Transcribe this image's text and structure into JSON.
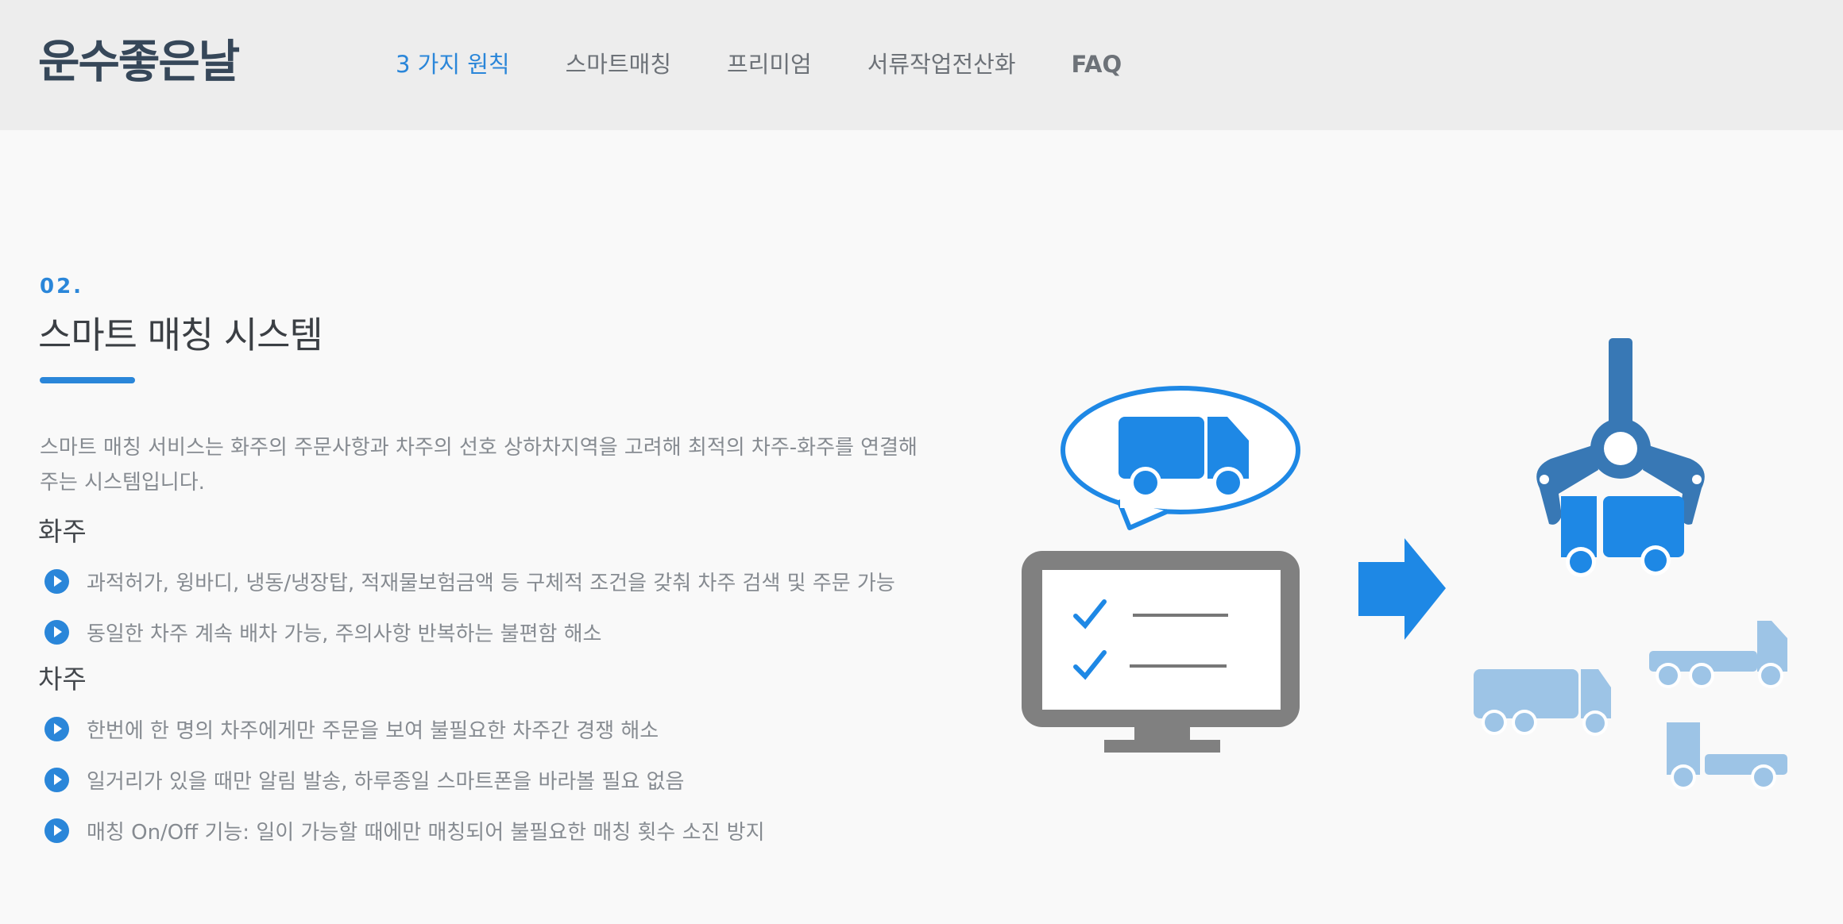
{
  "header": {
    "logo": "운수좋은날",
    "nav": [
      "3 가지 원칙",
      "스마트매칭",
      "프리미엄",
      "서류작업전산화",
      "FAQ"
    ]
  },
  "section": {
    "number": "02.",
    "title": "스마트 매칭 시스템",
    "intro": "스마트 매칭 서비스는 화주의 주문사항과 차주의 선호 상하차지역을 고려해 최적의 차주-화주를 연결해 주는 시스템입니다.",
    "shipper": {
      "heading": "화주",
      "items": [
        "과적허가, 윙바디, 냉동/냉장탑, 적재물보험금액 등 구체적 조건을 갖춰 차주 검색 및 주문 가능",
        "동일한 차주 계속 배차 가능, 주의사항 반복하는 불편함 해소"
      ]
    },
    "driver": {
      "heading": "차주",
      "items": [
        "한번에 한 명의 차주에게만 주문을 보여 불필요한 차주간 경쟁 해소",
        "일거리가 있을 때만 알림 발송, 하루종일 스마트폰을 바라볼 필요 없음",
        "매칭 On/Off 기능: 일이 가능할 때에만 매칭되어 불필요한 매칭 횟수 소진 방지"
      ]
    }
  },
  "colors": {
    "accent": "#2a86d9",
    "truck_blue": "#1e88e5",
    "truck_light": "#9dc4e6",
    "claw": "#3878b5",
    "monitor": "#808080"
  }
}
